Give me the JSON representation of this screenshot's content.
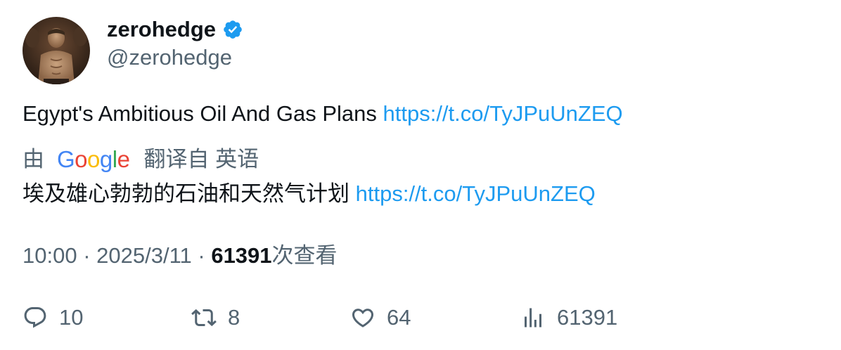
{
  "author": {
    "display_name": "zerohedge",
    "handle": "@zerohedge",
    "verified": true
  },
  "tweet": {
    "text": "Egypt's Ambitious Oil And Gas Plans ",
    "link": "https://t.co/TyJPuUnZEQ"
  },
  "translation": {
    "by_label": "由",
    "google_logo": "Google",
    "from_label": "翻译自 英语",
    "text": "埃及雄心勃勃的石油和天然气计划 ",
    "link": "https://t.co/TyJPuUnZEQ"
  },
  "meta": {
    "time": "10:00",
    "separator": " · ",
    "date": "2025/3/11",
    "views_count": "61391",
    "views_label": "次查看"
  },
  "actions": {
    "replies": "10",
    "retweets": "8",
    "likes": "64",
    "views": "61391"
  },
  "colors": {
    "link": "#1d9bf0",
    "secondary_text": "#536471",
    "primary_text": "#0f1419",
    "verified": "#1d9bf0"
  },
  "icons": [
    "verified-badge-icon",
    "reply-icon",
    "retweet-icon",
    "like-icon",
    "views-icon"
  ]
}
